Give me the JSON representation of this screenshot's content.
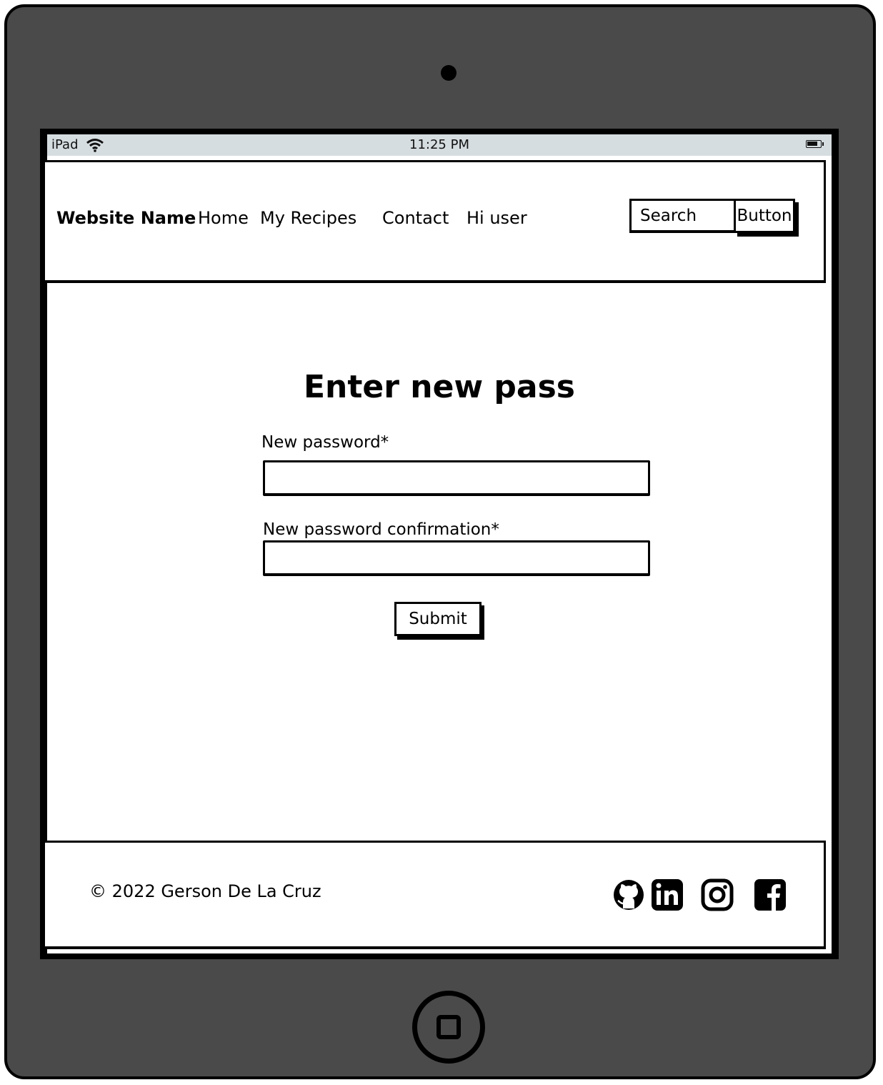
{
  "status_bar": {
    "device": "iPad",
    "time": "11:25 PM"
  },
  "navbar": {
    "brand": "Website Name",
    "links": [
      "Home",
      "My Recipes",
      "Contact",
      "Hi user"
    ],
    "search_placeholder": "Search",
    "search_button": "Button"
  },
  "main": {
    "title": "Enter new pass",
    "fields": [
      {
        "label": "New password*"
      },
      {
        "label": "New password confirmation*"
      }
    ],
    "submit": "Submit"
  },
  "footer": {
    "copyright": "© 2022 Gerson De La Cruz",
    "social_icons": [
      "github-icon",
      "linkedin-icon",
      "instagram-icon",
      "facebook-icon"
    ]
  },
  "colors": {
    "device_body": "#4a4a4a",
    "status_bar": "#d6dde0",
    "ink": "#000000"
  }
}
